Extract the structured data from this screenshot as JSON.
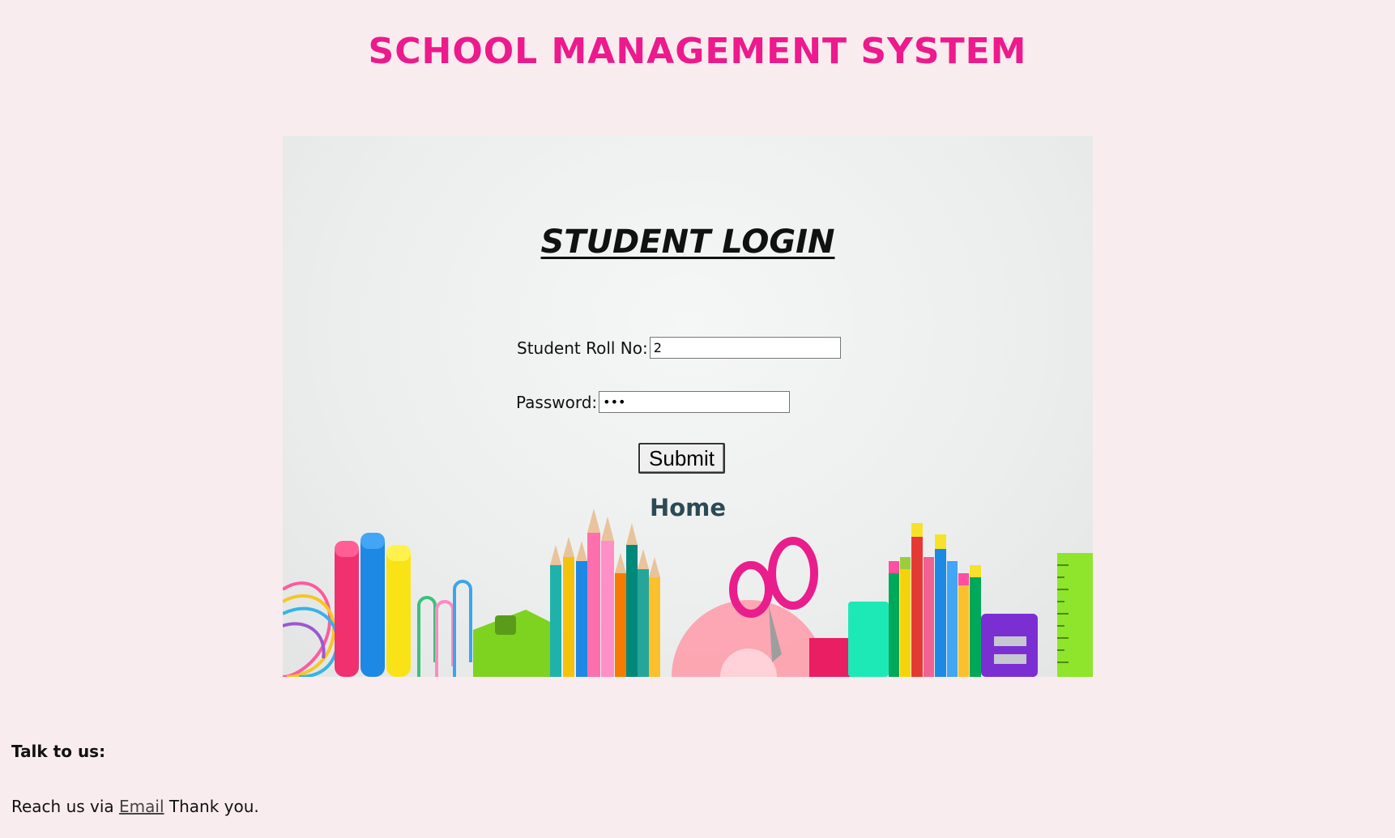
{
  "header": {
    "title": "SCHOOL MANAGEMENT SYSTEM",
    "title_color": "#ec1a8c"
  },
  "login": {
    "title": "STUDENT LOGIN",
    "roll_label": "Student Roll No:",
    "roll_value": "2",
    "password_label": "Password:",
    "password_value": "abc",
    "submit_label": "Submit",
    "home_link": "Home"
  },
  "footer": {
    "heading": "Talk to us:",
    "text_before": "Reach us via ",
    "email_link": "Email",
    "text_after": " Thank you."
  },
  "colors": {
    "page_background": "#f9ecee",
    "accent_pink": "#ec1a8c",
    "home_link": "#2c4a54"
  },
  "icons": {
    "hero_image": "school-supplies-image"
  }
}
